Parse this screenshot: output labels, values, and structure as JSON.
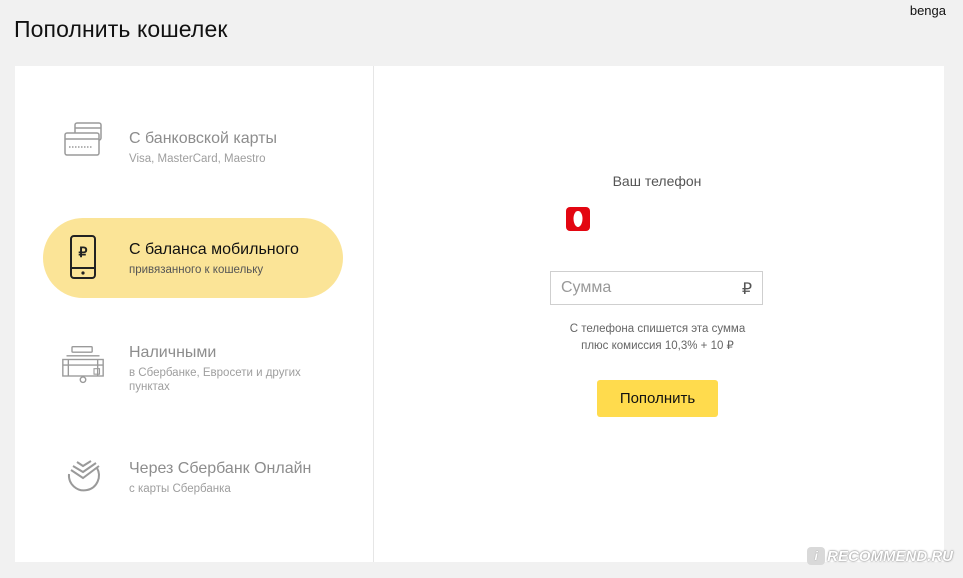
{
  "header": {
    "title": "Пополнить кошелек",
    "username": "benga"
  },
  "methods": [
    {
      "title": "С банковской карты",
      "subtitle": "Visa, MasterCard, Maestro",
      "icon": "bank-card-icon",
      "active": false
    },
    {
      "title": "С баланса мобильного",
      "subtitle": "привязанного к кошельку",
      "icon": "mobile-ruble-icon",
      "active": true
    },
    {
      "title": "Наличными",
      "subtitle": "в Сбербанке, Евросети и других пунктах",
      "icon": "cash-terminal-icon",
      "active": false
    },
    {
      "title": "Через Сбербанк Онлайн",
      "subtitle": "с карты Сбербанка",
      "icon": "sberbank-logo-icon",
      "active": false
    }
  ],
  "form": {
    "phone_label": "Ваш телефон",
    "operator_icon": "mts-logo-icon",
    "amount_placeholder": "Сумма",
    "amount_value": "",
    "currency": "₽",
    "commission_line1": "С телефона спишется эта сумма",
    "commission_line2": "плюс комиссия 10,3% + 10 ₽",
    "submit_label": "Пополнить"
  },
  "watermark": {
    "badge": "i",
    "text": "RECOMMEND.RU"
  },
  "colors": {
    "accent": "#ffdb4d",
    "active_bg": "#fbe497",
    "operator_red": "#e30611"
  }
}
